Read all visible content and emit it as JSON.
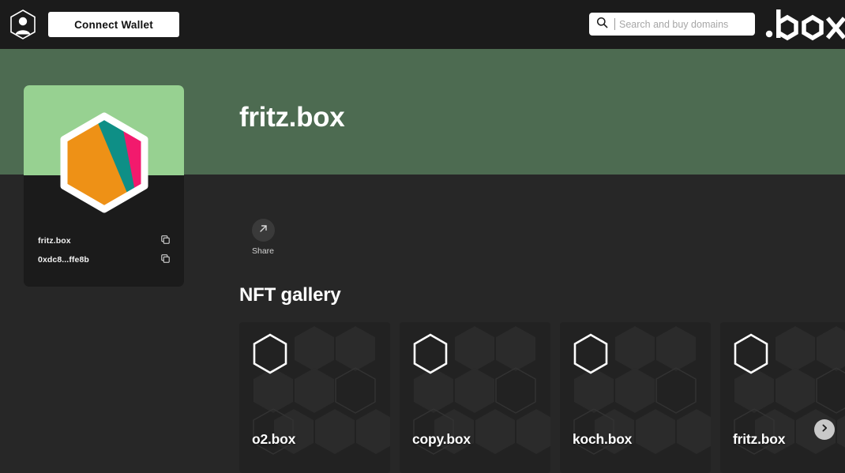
{
  "topbar": {
    "avatar_icon": "user-hexagon-icon",
    "connect_wallet_label": "Connect Wallet",
    "search": {
      "icon": "search-icon",
      "value": "",
      "placeholder": "Search and buy domains"
    },
    "brand": ".box"
  },
  "banner": {
    "background_color": "#4d6b51",
    "title": "fritz.box"
  },
  "profile_card": {
    "background_color": "#1b1b1b",
    "cover_color": "#97d191",
    "avatar": {
      "name": "avatar-hexagon",
      "colors": {
        "orange": "#ee9116",
        "teal": "#0e8f86",
        "pink": "#f21a6d",
        "border": "#ffffff"
      }
    },
    "rows": [
      {
        "label": "fritz.box",
        "copy_icon": "copy-icon"
      },
      {
        "label": "0xdc8...ffe8b",
        "copy_icon": "copy-icon"
      }
    ]
  },
  "actions": {
    "share": {
      "icon": "arrow-up-right-icon",
      "label": "Share"
    }
  },
  "gallery": {
    "title": "NFT gallery",
    "items": [
      {
        "name": "o2.box"
      },
      {
        "name": "copy.box"
      },
      {
        "name": "koch.box"
      },
      {
        "name": "fritz.box"
      }
    ],
    "next_button": {
      "icon": "chevron-right-icon",
      "label": ""
    }
  }
}
